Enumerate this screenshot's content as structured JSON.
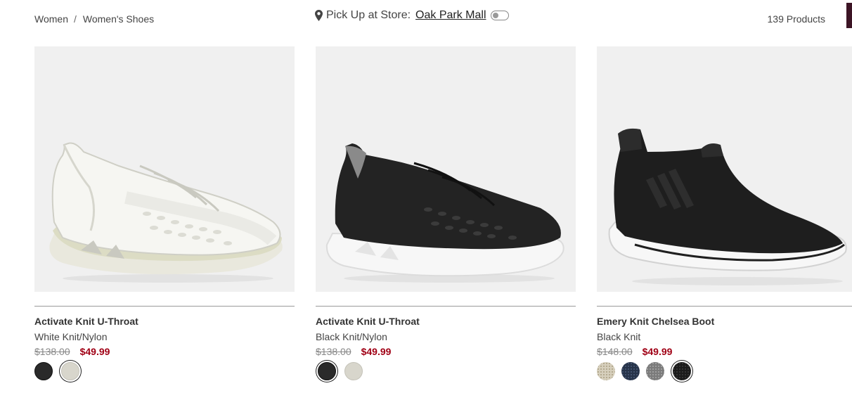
{
  "breadcrumb": {
    "root": "Women",
    "separator": "/",
    "current": "Women's Shoes"
  },
  "pickup": {
    "label": "Pick Up at Store:",
    "store": "Oak Park Mall",
    "toggle_on": false
  },
  "product_count": "139 Products",
  "colors": {
    "sale": "#a00015",
    "accent": "#3c1425",
    "image_bg": "#f0f0f0"
  },
  "products": [
    {
      "name": "Activate Knit U-Throat",
      "color": "White Knit/Nylon",
      "original_price": "$138.00",
      "sale_price": "$49.99",
      "swatches": [
        "black",
        "cream"
      ],
      "selected_swatch": 1
    },
    {
      "name": "Activate Knit U-Throat",
      "color": "Black Knit/Nylon",
      "original_price": "$138.00",
      "sale_price": "$49.99",
      "swatches": [
        "black",
        "cream"
      ],
      "selected_swatch": 0
    },
    {
      "name": "Emery Knit Chelsea Boot",
      "color": "Black Knit",
      "original_price": "$148.00",
      "sale_price": "$49.99",
      "swatches": [
        "tan",
        "navy",
        "grey",
        "black"
      ],
      "selected_swatch": 3
    }
  ]
}
